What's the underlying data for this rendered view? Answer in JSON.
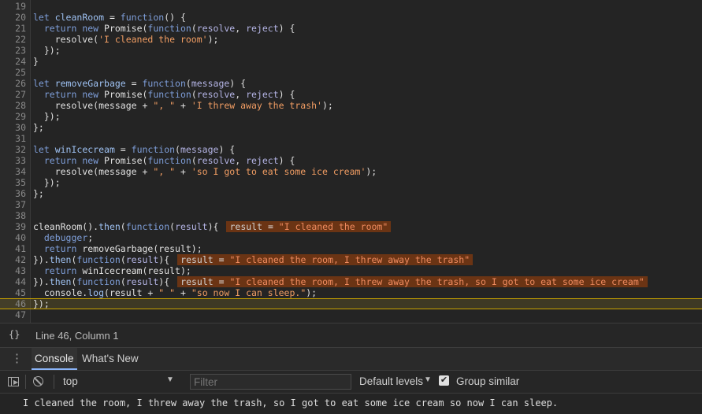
{
  "editor": {
    "current_line": 46,
    "lines": [
      {
        "n": "19",
        "tokens": []
      },
      {
        "n": "20",
        "tokens": [
          [
            "kw",
            "let "
          ],
          [
            "fn",
            "cleanRoom"
          ],
          [
            "op",
            " = "
          ],
          [
            "kw",
            "function"
          ],
          [
            "op",
            "() {"
          ]
        ]
      },
      {
        "n": "21",
        "tokens": [
          [
            "op",
            "  "
          ],
          [
            "kw",
            "return new "
          ],
          [
            "op",
            "Promise("
          ],
          [
            "kw",
            "function"
          ],
          [
            "op",
            "("
          ],
          [
            "pr",
            "resolve"
          ],
          [
            "op",
            ", "
          ],
          [
            "pr",
            "reject"
          ],
          [
            "op",
            ") {"
          ]
        ]
      },
      {
        "n": "22",
        "tokens": [
          [
            "op",
            "    resolve("
          ],
          [
            "st",
            "'I cleaned the room'"
          ],
          [
            "op",
            ");"
          ]
        ]
      },
      {
        "n": "23",
        "tokens": [
          [
            "op",
            "  });"
          ]
        ]
      },
      {
        "n": "24",
        "tokens": [
          [
            "op",
            "}"
          ]
        ]
      },
      {
        "n": "25",
        "tokens": []
      },
      {
        "n": "26",
        "tokens": [
          [
            "kw",
            "let "
          ],
          [
            "fn",
            "removeGarbage"
          ],
          [
            "op",
            " = "
          ],
          [
            "kw",
            "function"
          ],
          [
            "op",
            "("
          ],
          [
            "pr",
            "message"
          ],
          [
            "op",
            ") {"
          ]
        ]
      },
      {
        "n": "27",
        "tokens": [
          [
            "op",
            "  "
          ],
          [
            "kw",
            "return new "
          ],
          [
            "op",
            "Promise("
          ],
          [
            "kw",
            "function"
          ],
          [
            "op",
            "("
          ],
          [
            "pr",
            "resolve"
          ],
          [
            "op",
            ", "
          ],
          [
            "pr",
            "reject"
          ],
          [
            "op",
            ") {"
          ]
        ]
      },
      {
        "n": "28",
        "tokens": [
          [
            "op",
            "    resolve(message + "
          ],
          [
            "st",
            "\", \""
          ],
          [
            "op",
            " + "
          ],
          [
            "st",
            "'I threw away the trash'"
          ],
          [
            "op",
            ");"
          ]
        ]
      },
      {
        "n": "29",
        "tokens": [
          [
            "op",
            "  });"
          ]
        ]
      },
      {
        "n": "30",
        "tokens": [
          [
            "op",
            "};"
          ]
        ]
      },
      {
        "n": "31",
        "tokens": []
      },
      {
        "n": "32",
        "tokens": [
          [
            "kw",
            "let "
          ],
          [
            "fn",
            "winIcecream"
          ],
          [
            "op",
            " = "
          ],
          [
            "kw",
            "function"
          ],
          [
            "op",
            "("
          ],
          [
            "pr",
            "message"
          ],
          [
            "op",
            ") {"
          ]
        ]
      },
      {
        "n": "33",
        "tokens": [
          [
            "op",
            "  "
          ],
          [
            "kw",
            "return new "
          ],
          [
            "op",
            "Promise("
          ],
          [
            "kw",
            "function"
          ],
          [
            "op",
            "("
          ],
          [
            "pr",
            "resolve"
          ],
          [
            "op",
            ", "
          ],
          [
            "pr",
            "reject"
          ],
          [
            "op",
            ") {"
          ]
        ]
      },
      {
        "n": "34",
        "tokens": [
          [
            "op",
            "    resolve(message + "
          ],
          [
            "st",
            "\", \""
          ],
          [
            "op",
            " + "
          ],
          [
            "st",
            "'so I got to eat some ice cream'"
          ],
          [
            "op",
            ");"
          ]
        ]
      },
      {
        "n": "35",
        "tokens": [
          [
            "op",
            "  });"
          ]
        ]
      },
      {
        "n": "36",
        "tokens": [
          [
            "op",
            "};"
          ]
        ]
      },
      {
        "n": "37",
        "tokens": []
      },
      {
        "n": "38",
        "tokens": []
      },
      {
        "n": "39",
        "tokens": [
          [
            "op",
            "cleanRoom()."
          ],
          [
            "fn",
            "then"
          ],
          [
            "op",
            "("
          ],
          [
            "kw",
            "function"
          ],
          [
            "op",
            "("
          ],
          [
            "pr",
            "result"
          ],
          [
            "op",
            "){"
          ]
        ],
        "inline": {
          "name": "result",
          "value": "\"I cleaned the room\""
        }
      },
      {
        "n": "40",
        "tokens": [
          [
            "op",
            "  "
          ],
          [
            "kw",
            "debugger"
          ],
          [
            "op",
            ";"
          ]
        ]
      },
      {
        "n": "41",
        "tokens": [
          [
            "op",
            "  "
          ],
          [
            "kw",
            "return "
          ],
          [
            "op",
            "removeGarbage(result);"
          ]
        ]
      },
      {
        "n": "42",
        "tokens": [
          [
            "op",
            "})."
          ],
          [
            "fn",
            "then"
          ],
          [
            "op",
            "("
          ],
          [
            "kw",
            "function"
          ],
          [
            "op",
            "("
          ],
          [
            "pr",
            "result"
          ],
          [
            "op",
            "){"
          ]
        ],
        "inline": {
          "name": "result",
          "value": "\"I cleaned the room, I threw away the trash\""
        }
      },
      {
        "n": "43",
        "tokens": [
          [
            "op",
            "  "
          ],
          [
            "kw",
            "return "
          ],
          [
            "op",
            "winIcecream(result);"
          ]
        ]
      },
      {
        "n": "44",
        "tokens": [
          [
            "op",
            "})."
          ],
          [
            "fn",
            "then"
          ],
          [
            "op",
            "("
          ],
          [
            "kw",
            "function"
          ],
          [
            "op",
            "("
          ],
          [
            "pr",
            "result"
          ],
          [
            "op",
            "){"
          ]
        ],
        "inline": {
          "name": "result",
          "value": "\"I cleaned the room, I threw away the trash, so I got to eat some ice cream\""
        }
      },
      {
        "n": "45",
        "tokens": [
          [
            "op",
            "  console."
          ],
          [
            "fn",
            "log"
          ],
          [
            "op",
            "(result + "
          ],
          [
            "st",
            "\" \""
          ],
          [
            "op",
            " + "
          ],
          [
            "st",
            "\"so now I can sleep.\""
          ],
          [
            "op",
            ");"
          ]
        ]
      },
      {
        "n": "46",
        "tokens": [
          [
            "op",
            "});"
          ]
        ]
      },
      {
        "n": "47",
        "tokens": []
      }
    ]
  },
  "status": {
    "braces_icon": "{}",
    "position": "Line 46, Column 1"
  },
  "drawer": {
    "menu_icon": "⋮",
    "tabs": [
      {
        "label": "Console",
        "active": true
      },
      {
        "label": "What's New",
        "active": false
      }
    ]
  },
  "console_toolbar": {
    "context": "top",
    "filter_placeholder": "Filter",
    "levels": "Default levels",
    "group_similar_label": "Group similar",
    "group_similar_checked": true,
    "check_mark": "✔",
    "dropdown_arrow": "▼"
  },
  "console_output": {
    "message": "I cleaned the room, I threw away the trash, so I got to eat some ice cream so now I can sleep."
  },
  "colors": {
    "background": "#242424",
    "keyword": "#7e9ed9",
    "string": "#f19d63",
    "inline_value_bg": "#6b3414",
    "current_line_border": "#c9a300"
  }
}
